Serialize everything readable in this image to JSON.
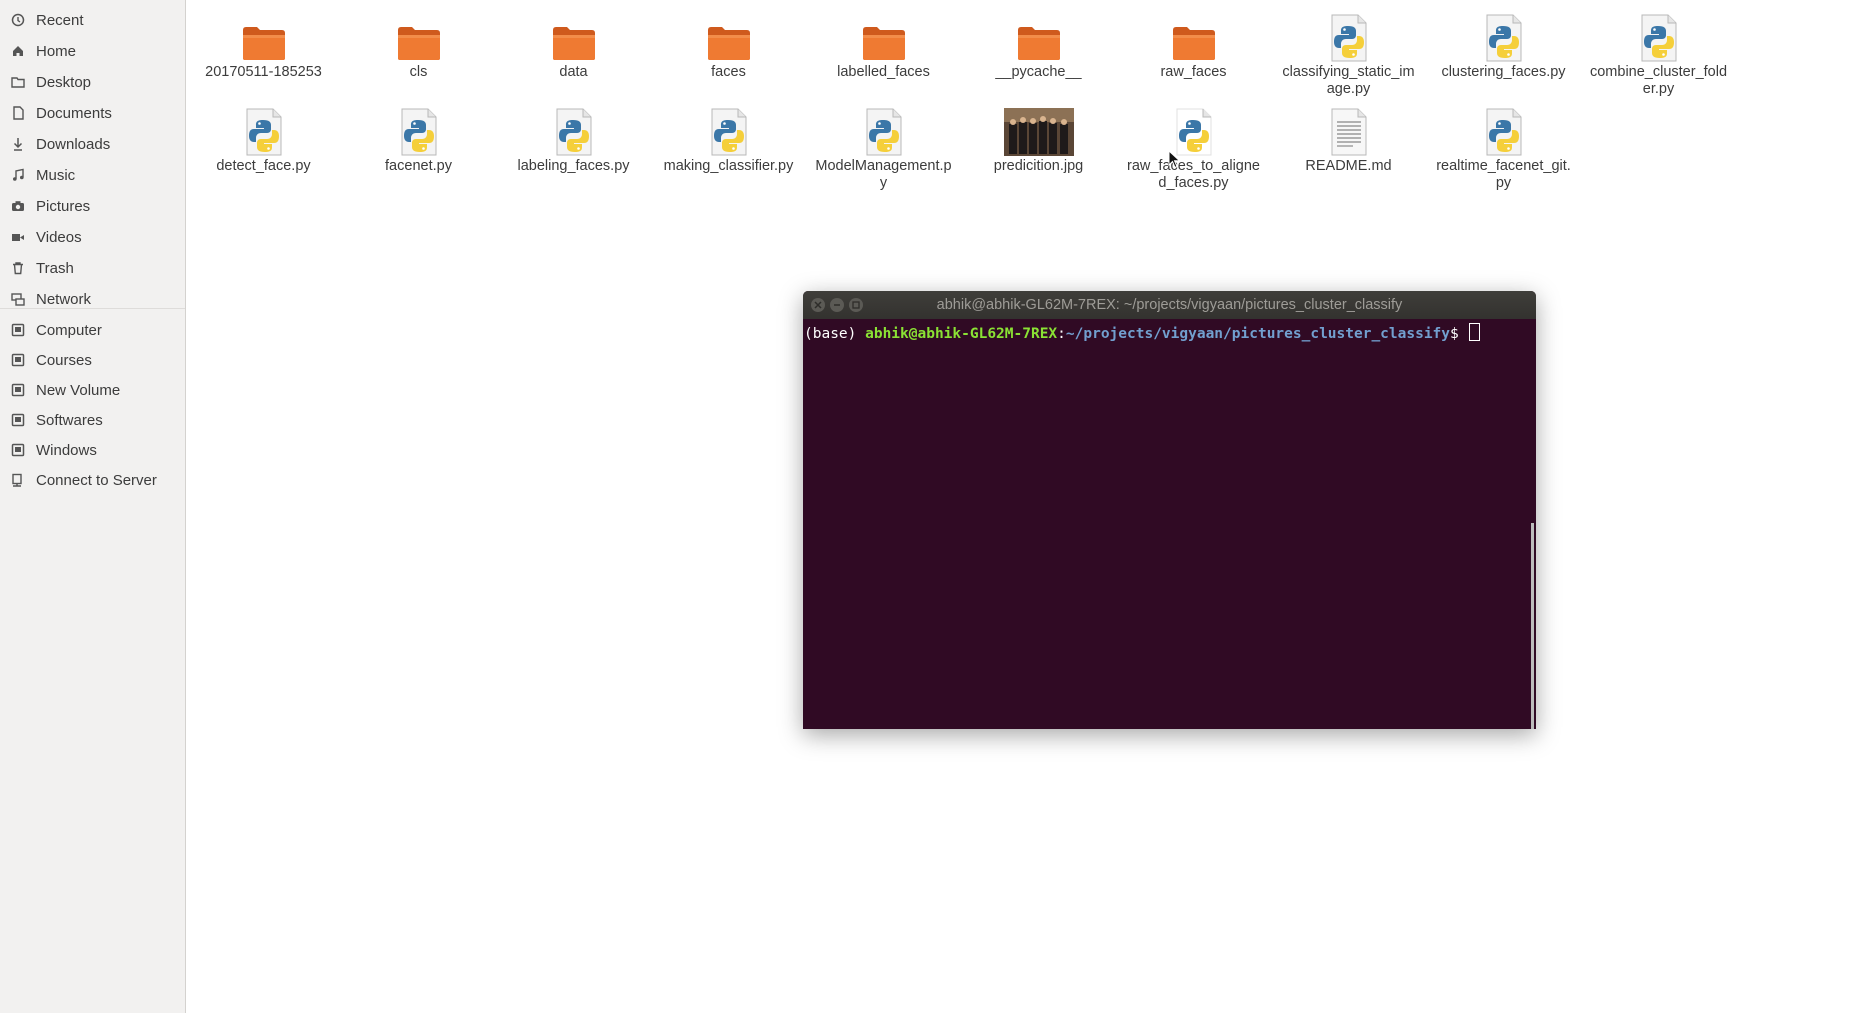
{
  "sidebar": {
    "items": [
      {
        "label": "Recent",
        "icon": "clock-icon"
      },
      {
        "label": "Home",
        "icon": "home-icon"
      },
      {
        "label": "Desktop",
        "icon": "folder-icon"
      },
      {
        "label": "Documents",
        "icon": "document-icon"
      },
      {
        "label": "Downloads",
        "icon": "download-icon"
      },
      {
        "label": "Music",
        "icon": "music-icon"
      },
      {
        "label": "Pictures",
        "icon": "camera-icon"
      },
      {
        "label": "Videos",
        "icon": "video-icon"
      },
      {
        "label": "Trash",
        "icon": "trash-icon"
      },
      {
        "label": "Network",
        "icon": "network-icon"
      },
      {
        "label": "Computer",
        "icon": "drive-icon"
      },
      {
        "label": "Courses",
        "icon": "drive-icon"
      },
      {
        "label": "New Volume",
        "icon": "drive-icon"
      },
      {
        "label": "Softwares",
        "icon": "drive-icon"
      },
      {
        "label": "Windows",
        "icon": "drive-icon"
      },
      {
        "label": "Connect to Server",
        "icon": "server-icon"
      }
    ]
  },
  "files": [
    {
      "name": "20170511-185253",
      "type": "folder"
    },
    {
      "name": "cls",
      "type": "folder"
    },
    {
      "name": "data",
      "type": "folder"
    },
    {
      "name": "faces",
      "type": "folder"
    },
    {
      "name": "labelled_faces",
      "type": "folder"
    },
    {
      "name": "__pycache__",
      "type": "folder"
    },
    {
      "name": "raw_faces",
      "type": "folder"
    },
    {
      "name": "classifying_static_image.py",
      "type": "python"
    },
    {
      "name": "clustering_faces.py",
      "type": "python"
    },
    {
      "name": "combine_cluster_folder.py",
      "type": "python"
    },
    {
      "name": "detect_face.py",
      "type": "python"
    },
    {
      "name": "facenet.py",
      "type": "python"
    },
    {
      "name": "labeling_faces.py",
      "type": "python"
    },
    {
      "name": "making_classifier.py",
      "type": "python"
    },
    {
      "name": "ModelManagement.py",
      "type": "python"
    },
    {
      "name": "predicition.jpg",
      "type": "image"
    },
    {
      "name": "raw_faces_to_aligned_faces.py",
      "type": "python-light"
    },
    {
      "name": "README.md",
      "type": "text"
    },
    {
      "name": "realtime_facenet_git.py",
      "type": "python"
    }
  ],
  "terminal": {
    "title": "abhik@abhik-GL62M-7REX: ~/projects/vigyaan/pictures_cluster_classify",
    "env": "(base) ",
    "user": "abhik@abhik-GL62M-7REX",
    "sep": ":",
    "path": "~/projects/vigyaan/pictures_cluster_classify",
    "prompt": "$ "
  },
  "colors": {
    "terminal_bg": "#300a24",
    "folder_orange": "#e9692c",
    "term_green": "#8ae234",
    "term_blue": "#729fcf"
  }
}
